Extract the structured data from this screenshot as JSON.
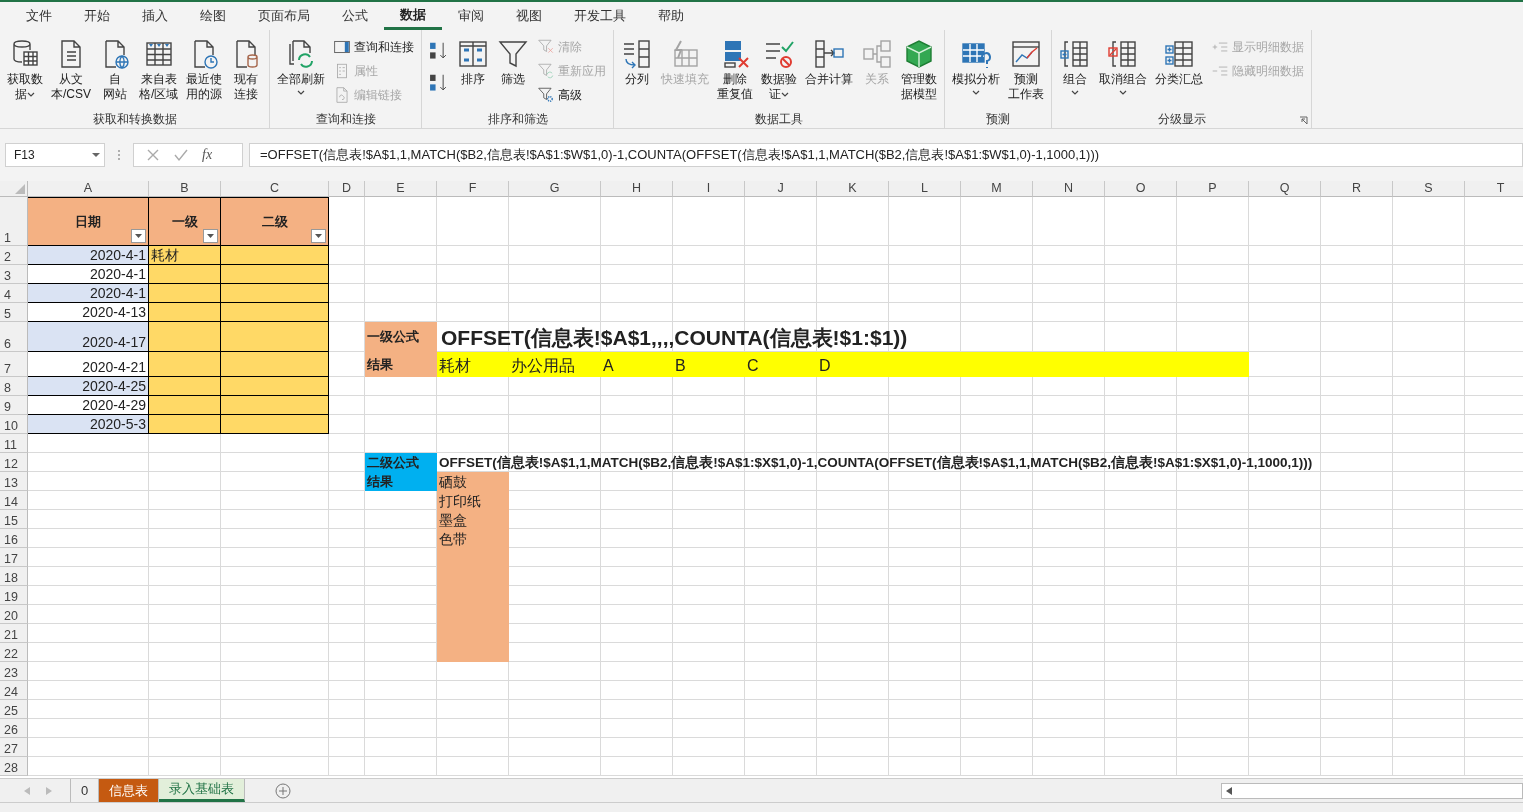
{
  "menu_tabs": [
    {
      "label": "文件",
      "selected": false
    },
    {
      "label": "开始",
      "selected": false
    },
    {
      "label": "插入",
      "selected": false
    },
    {
      "label": "绘图",
      "selected": false
    },
    {
      "label": "页面布局",
      "selected": false
    },
    {
      "label": "公式",
      "selected": false
    },
    {
      "label": "数据",
      "selected": true
    },
    {
      "label": "审阅",
      "selected": false
    },
    {
      "label": "视图",
      "selected": false
    },
    {
      "label": "开发工具",
      "selected": false
    },
    {
      "label": "帮助",
      "selected": false
    }
  ],
  "ribbon_groups": [
    {
      "title": "获取和转换数据",
      "launcher": false,
      "items": [
        {
          "kind": "large",
          "label": "获取数据",
          "dropdown": true,
          "disabled": false
        },
        {
          "kind": "large",
          "label": "从文本/CSV",
          "dropdown": false,
          "disabled": false
        },
        {
          "kind": "large",
          "label": "自网站",
          "dropdown": false,
          "disabled": false
        },
        {
          "kind": "large",
          "label": "来自表格/区域",
          "dropdown": false,
          "disabled": false
        },
        {
          "kind": "large",
          "label": "最近使用的源",
          "dropdown": false,
          "disabled": false
        },
        {
          "kind": "large",
          "label": "现有连接",
          "dropdown": false,
          "disabled": false
        }
      ]
    },
    {
      "title": "查询和连接",
      "launcher": false,
      "items": [
        {
          "kind": "large",
          "label": "全部刷新",
          "dropdown": true,
          "disabled": false
        },
        {
          "kind": "small",
          "label": "查询和连接",
          "dropdown": false,
          "disabled": false
        },
        {
          "kind": "small",
          "label": "属性",
          "dropdown": false,
          "disabled": true
        },
        {
          "kind": "small",
          "label": "编辑链接",
          "dropdown": false,
          "disabled": true
        }
      ]
    },
    {
      "title": "排序和筛选",
      "launcher": false,
      "items": [
        {
          "kind": "icon",
          "dropdown": false,
          "disabled": false
        },
        {
          "kind": "icon",
          "dropdown": false,
          "disabled": false
        },
        {
          "kind": "large",
          "label": "排序",
          "dropdown": false,
          "disabled": false
        },
        {
          "kind": "large",
          "label": "筛选",
          "dropdown": false,
          "disabled": false
        },
        {
          "kind": "small",
          "label": "清除",
          "dropdown": false,
          "disabled": true
        },
        {
          "kind": "small",
          "label": "重新应用",
          "dropdown": false,
          "disabled": true
        },
        {
          "kind": "small",
          "label": "高级",
          "dropdown": false,
          "disabled": false
        }
      ]
    },
    {
      "title": "数据工具",
      "launcher": false,
      "items": [
        {
          "kind": "large",
          "label": "分列",
          "dropdown": false,
          "disabled": false
        },
        {
          "kind": "large",
          "label": "快速填充",
          "dropdown": false,
          "disabled": true
        },
        {
          "kind": "large",
          "label": "删除重复值",
          "dropdown": false,
          "disabled": false
        },
        {
          "kind": "large",
          "label": "数据验证",
          "dropdown": true,
          "disabled": false
        },
        {
          "kind": "large",
          "label": "合并计算",
          "dropdown": false,
          "disabled": false
        },
        {
          "kind": "large",
          "label": "关系",
          "dropdown": false,
          "disabled": true
        },
        {
          "kind": "large",
          "label": "管理数据模型",
          "dropdown": false,
          "disabled": false
        }
      ]
    },
    {
      "title": "预测",
      "launcher": false,
      "items": [
        {
          "kind": "large",
          "label": "模拟分析",
          "dropdown": true,
          "disabled": false
        },
        {
          "kind": "large",
          "label": "预测工作表",
          "dropdown": false,
          "disabled": false
        }
      ]
    },
    {
      "title": "分级显示",
      "launcher": true,
      "items": [
        {
          "kind": "large",
          "label": "组合",
          "dropdown": true,
          "disabled": false
        },
        {
          "kind": "large",
          "label": "取消组合",
          "dropdown": true,
          "disabled": false
        },
        {
          "kind": "large",
          "label": "分类汇总",
          "dropdown": false,
          "disabled": false
        },
        {
          "kind": "small",
          "label": "显示明细数据",
          "dropdown": false,
          "disabled": true
        },
        {
          "kind": "small",
          "label": "隐藏明细数据",
          "dropdown": false,
          "disabled": true
        }
      ]
    }
  ],
  "formula_bar": {
    "name_box": "F13",
    "function_label": "fx",
    "formula": "=OFFSET(信息表!$A$1,1,MATCH($B2,信息表!$A$1:$W$1,0)-1,COUNTA(OFFSET(信息表!$A$1,1,MATCH($B2,信息表!$A$1:$W$1,0)-1,1000,1)))"
  },
  "sheet": {
    "columns": [
      "A",
      "B",
      "C",
      "D",
      "E",
      "F",
      "G",
      "H",
      "I",
      "J",
      "K",
      "L",
      "M",
      "N",
      "O",
      "P",
      "Q",
      "R",
      "S",
      "T"
    ],
    "rows": [
      "1",
      "2",
      "3",
      "4",
      "5",
      "6",
      "7",
      "8",
      "9",
      "10",
      "11",
      "12",
      "13",
      "14",
      "15",
      "16",
      "17",
      "18",
      "19",
      "20",
      "21",
      "22",
      "23",
      "24",
      "25",
      "26",
      "27",
      "28"
    ],
    "table": {
      "headers": [
        {
          "text": "日期",
          "filter": true
        },
        {
          "text": "一级",
          "filter": true
        },
        {
          "text": "二级",
          "filter": true
        }
      ],
      "rows": [
        [
          "2020-4-1",
          "耗材"
        ],
        [
          "2020-4-1"
        ],
        [
          "2020-4-1"
        ],
        [
          "2020-4-13"
        ],
        [
          "2020-4-17"
        ],
        [
          "2020-4-21"
        ],
        [
          "2020-4-25"
        ],
        [
          "2020-4-29"
        ],
        [
          "2020-5-3"
        ]
      ]
    },
    "formula_blocks": [
      {
        "kind": "horizontal",
        "label": "一级公式",
        "formula": "OFFSET(信息表!$A$1,,,,COUNTA(信息表!$1:$1))",
        "result_label": "结果",
        "results": [
          "耗材",
          "办公用品",
          "A",
          "B",
          "C",
          "D"
        ]
      },
      {
        "kind": "vertical",
        "label": "二级公式",
        "formula": "OFFSET(信息表!$A$1,1,MATCH($B2,信息表!$A$1:$X$1,0)-1,COUNTA(OFFSET(信息表!$A$1,1,MATCH($B2,信息表!$A$1:$X$1,0)-1,1000,1)))",
        "result_label": "结果",
        "results": [
          "硒鼓",
          "打印纸",
          "墨盒",
          "色带"
        ]
      }
    ]
  },
  "sheet_tabs": [
    {
      "label": "0",
      "selected": false
    },
    {
      "label": "信息表",
      "selected": false,
      "color": "#c55a11"
    },
    {
      "label": "录入基础表",
      "selected": true
    }
  ]
}
